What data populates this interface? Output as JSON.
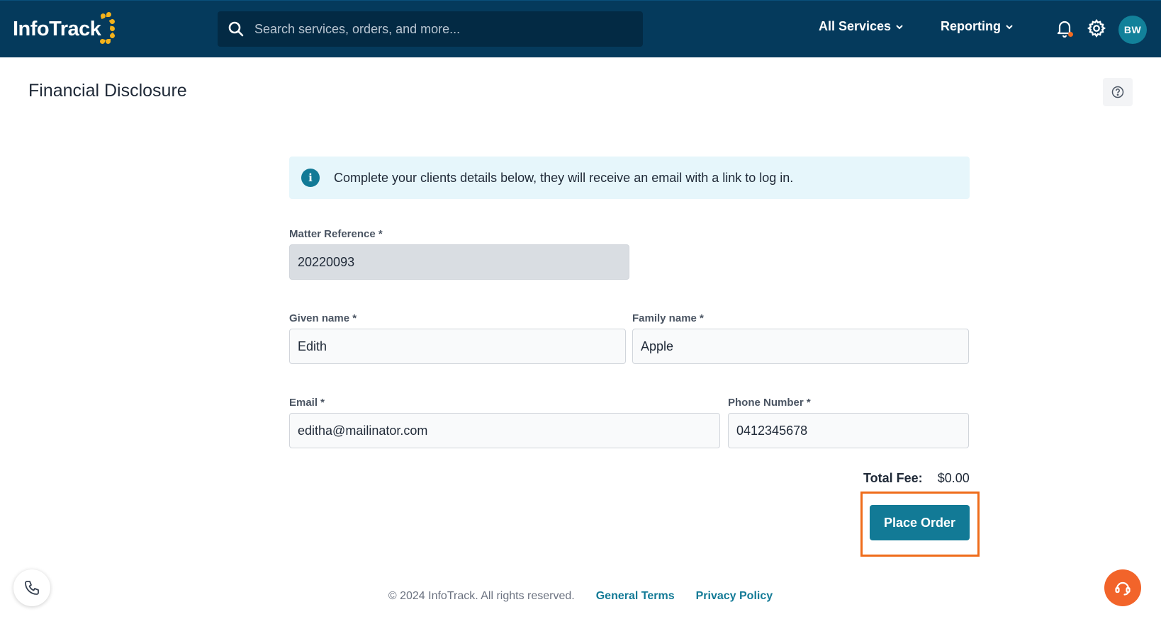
{
  "header": {
    "logo_text": "InfoTrack",
    "search_placeholder": "Search services, orders, and more...",
    "nav": [
      {
        "label": "All Services"
      },
      {
        "label": "Reporting"
      }
    ],
    "avatar_initials": "BW",
    "colors": {
      "bar": "#053a5c",
      "accent": "#12819a",
      "logo_mark": "#f5b21b",
      "notification_dot": "#f36b21"
    }
  },
  "page": {
    "title": "Financial Disclosure"
  },
  "info_banner": {
    "icon": "info-icon",
    "message": "Complete your clients details below, they will receive an email with a link to log in."
  },
  "form": {
    "matter_reference": {
      "label": "Matter Reference *",
      "value": "20220093",
      "disabled": true
    },
    "given_name": {
      "label": "Given name *",
      "value": "Edith"
    },
    "family_name": {
      "label": "Family name *",
      "value": "Apple"
    },
    "email": {
      "label": "Email *",
      "value": "editha@mailinator.com"
    },
    "phone": {
      "label": "Phone Number *",
      "value": "0412345678"
    }
  },
  "order": {
    "total_label": "Total Fee:",
    "total_value": "$0.00",
    "place_order_label": "Place Order",
    "highlight_color": "#ef6c1a"
  },
  "footer": {
    "copyright": "© 2024 InfoTrack. All rights reserved.",
    "links": [
      {
        "label": "General Terms"
      },
      {
        "label": "Privacy Policy"
      }
    ]
  }
}
